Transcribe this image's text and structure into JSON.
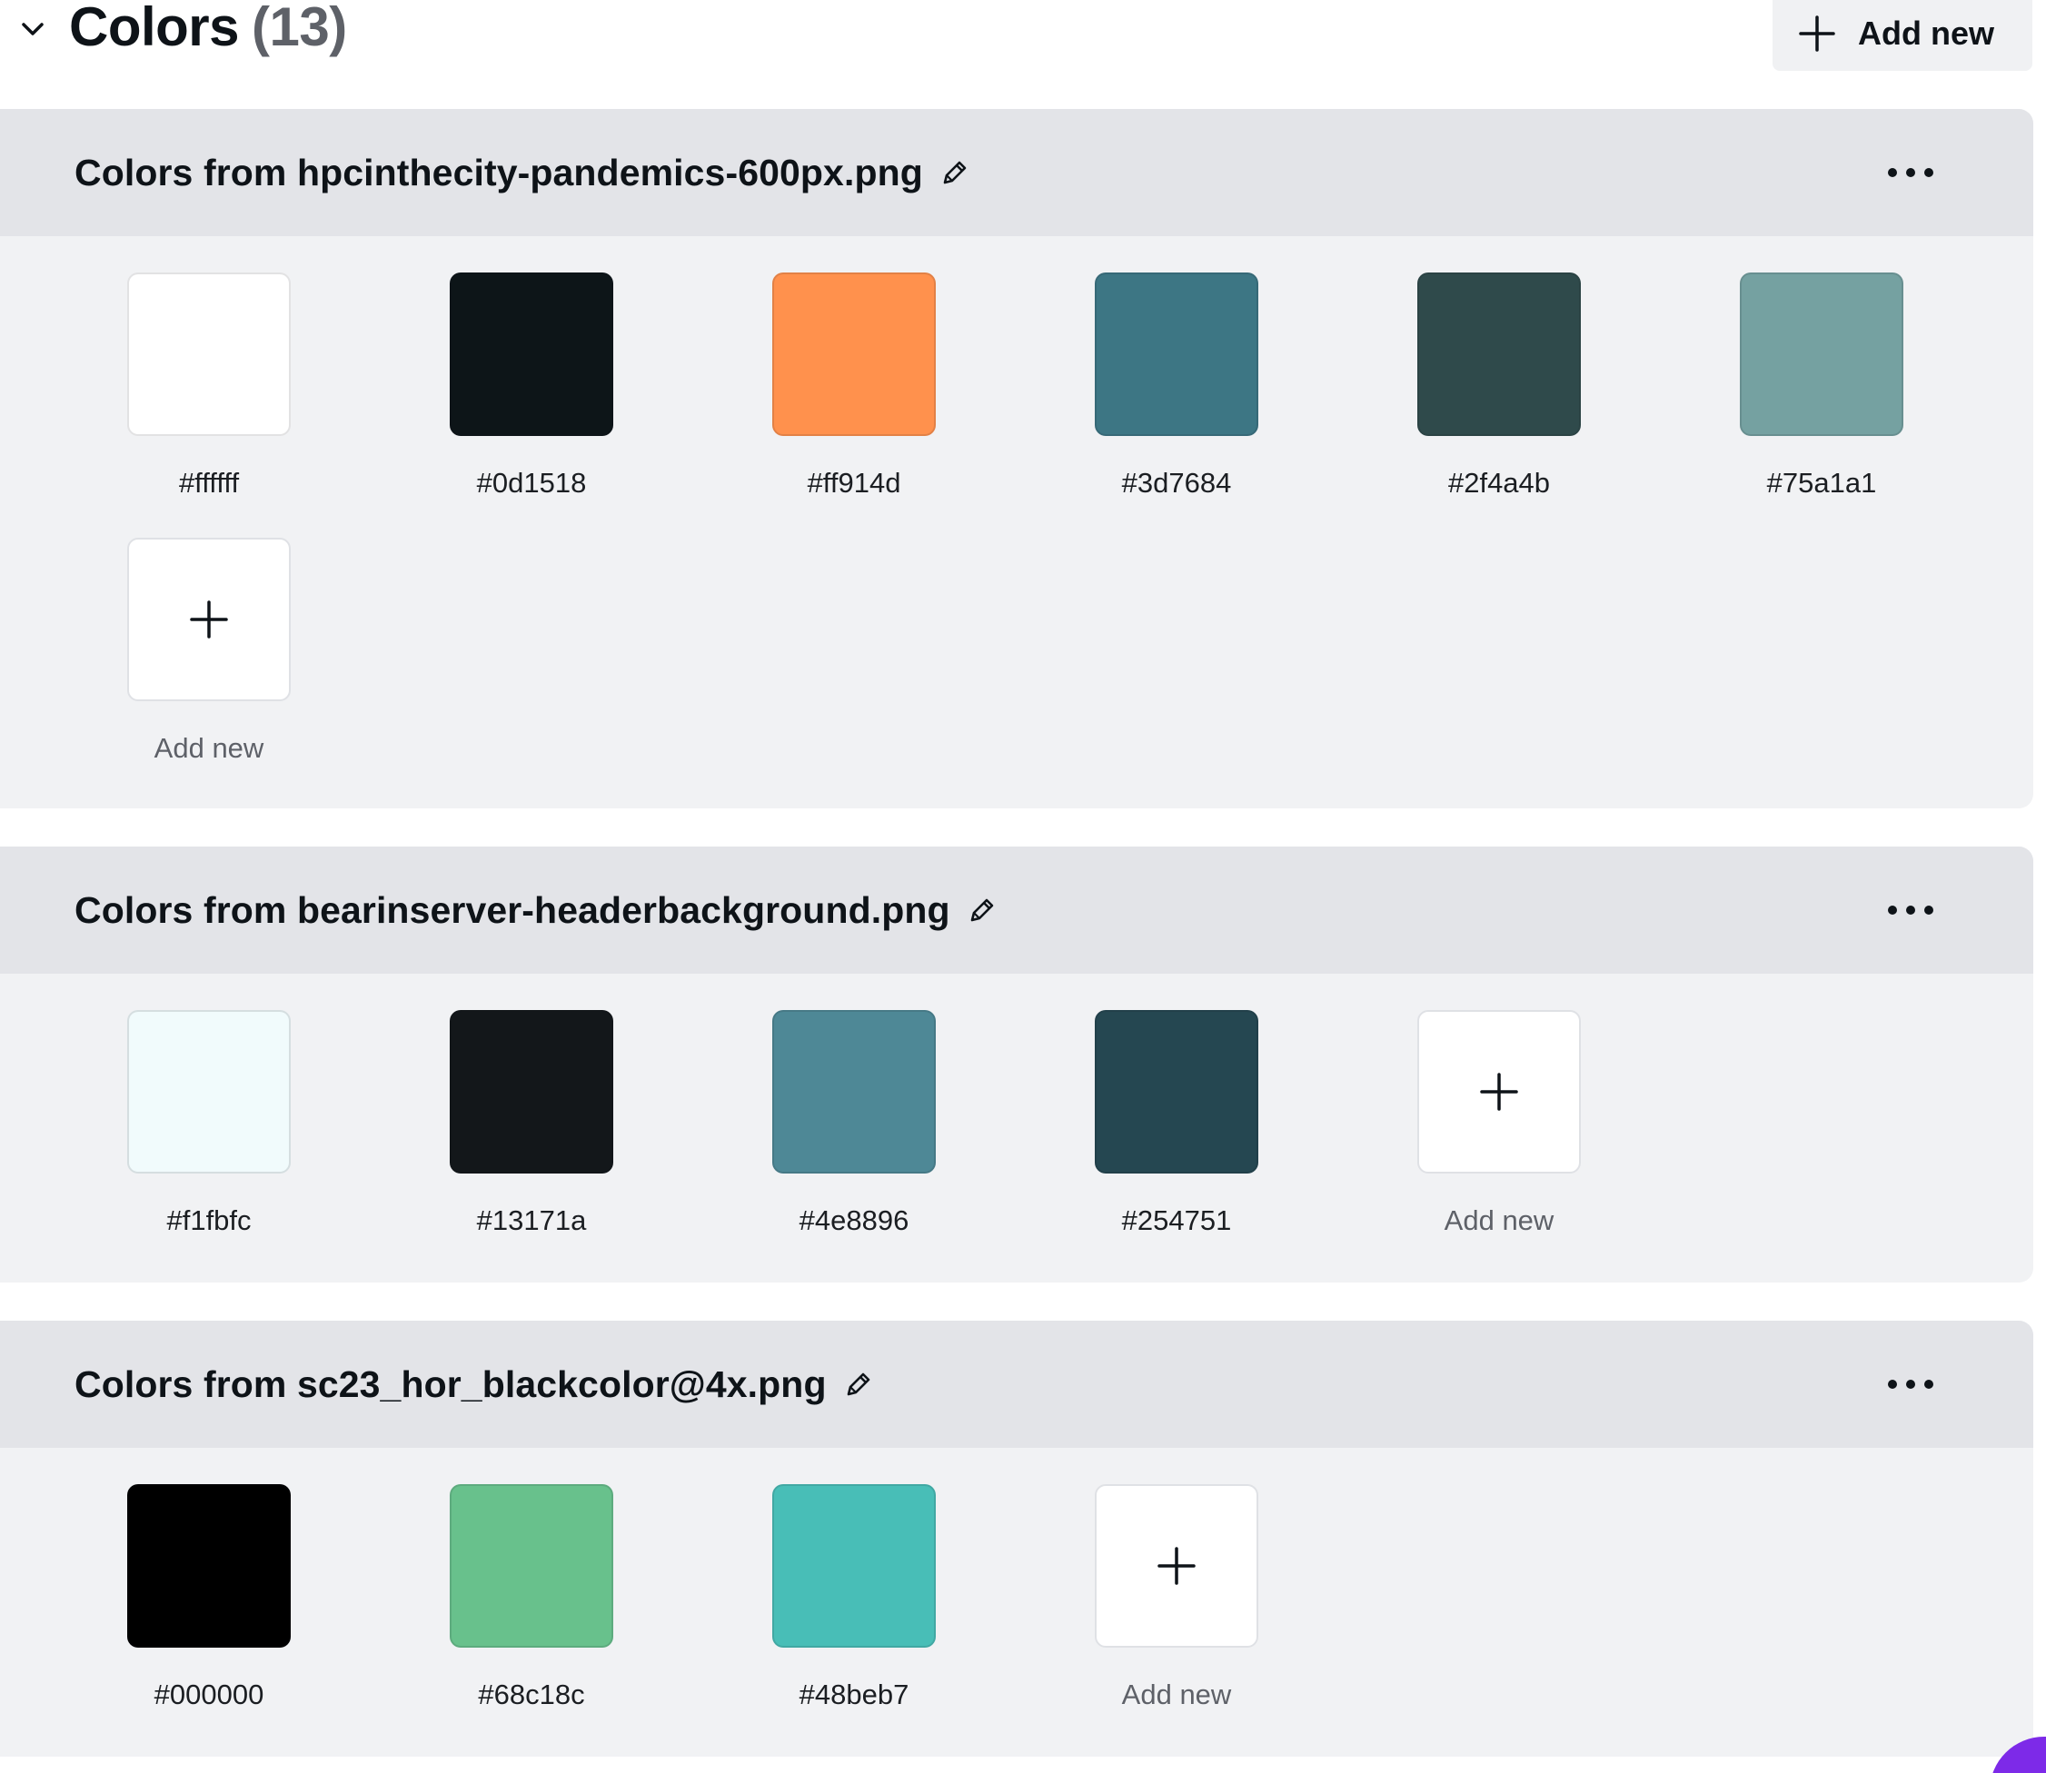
{
  "section": {
    "title": "Colors",
    "count": "(13)",
    "add_new_label": "Add new",
    "collapse_icon": "chevron-down-icon",
    "add_icon": "plus-icon"
  },
  "palettes": [
    {
      "title": "Colors from hpcinthecity-pandemics-600px.png",
      "swatches": [
        {
          "hex": "#ffffff",
          "label": "#ffffff"
        },
        {
          "hex": "#0d1518",
          "label": "#0d1518"
        },
        {
          "hex": "#ff914d",
          "label": "#ff914d"
        },
        {
          "hex": "#3d7684",
          "label": "#3d7684"
        },
        {
          "hex": "#2f4a4b",
          "label": "#2f4a4b"
        },
        {
          "hex": "#75a1a1",
          "label": "#75a1a1"
        }
      ],
      "add_new_label": "Add new"
    },
    {
      "title": "Colors from bearinserver-headerbackground.png",
      "swatches": [
        {
          "hex": "#f1fbfc",
          "label": "#f1fbfc"
        },
        {
          "hex": "#13171a",
          "label": "#13171a"
        },
        {
          "hex": "#4e8896",
          "label": "#4e8896"
        },
        {
          "hex": "#254751",
          "label": "#254751"
        }
      ],
      "add_new_label": "Add new"
    },
    {
      "title": "Colors from sc23_hor_blackcolor@4x.png",
      "swatches": [
        {
          "hex": "#000000",
          "label": "#000000"
        },
        {
          "hex": "#68c18c",
          "label": "#68c18c"
        },
        {
          "hex": "#48beb7",
          "label": "#48beb7"
        }
      ],
      "add_new_label": "Add new"
    }
  ],
  "colors": {
    "page_bg": "#ffffff",
    "card_bg": "#f1f2f4",
    "card_header_bg": "#e3e4e8",
    "add_button_bg": "#f0f1f3",
    "accent": "#7d2ae8"
  }
}
